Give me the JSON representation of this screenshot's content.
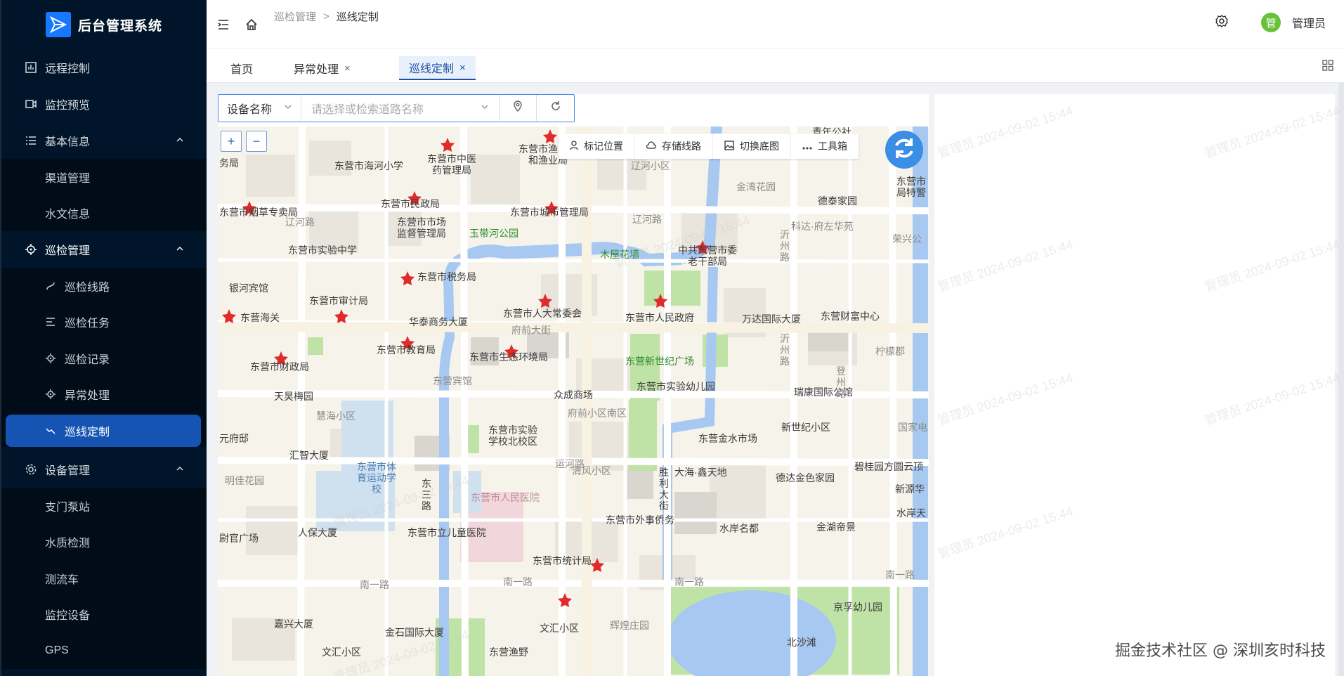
{
  "app": {
    "title": "后台管理系统"
  },
  "sidebar": {
    "items": [
      {
        "label": "远程控制"
      },
      {
        "label": "监控预览"
      },
      {
        "label": "基本信息"
      },
      {
        "label": "渠道管理"
      },
      {
        "label": "水文信息"
      },
      {
        "label": "巡检管理"
      },
      {
        "label": "巡检线路"
      },
      {
        "label": "巡检任务"
      },
      {
        "label": "巡检记录"
      },
      {
        "label": "异常处理"
      },
      {
        "label": "巡线定制"
      },
      {
        "label": "设备管理"
      },
      {
        "label": "支门泵站"
      },
      {
        "label": "水质检测"
      },
      {
        "label": "测流车"
      },
      {
        "label": "监控设备"
      },
      {
        "label": "GPS"
      }
    ]
  },
  "header": {
    "breadcrumb": [
      "巡检管理",
      ">",
      "巡线定制"
    ],
    "user": {
      "avatar_char": "管",
      "name": "管理员"
    }
  },
  "tabs": [
    {
      "label": "首页"
    },
    {
      "label": "异常处理"
    },
    {
      "label": "巡线定制"
    }
  ],
  "search": {
    "select_value": "设备名称",
    "placeholder": "请选择或检索道路名称"
  },
  "map": {
    "zoom_in": "+",
    "zoom_out": "−",
    "toolbar": [
      "标记位置",
      "存储线路",
      "切换底图",
      "工具箱"
    ],
    "roads": [
      "辽河路",
      "辽河路",
      "府前大街",
      "运河路",
      "南一路",
      "南一路",
      "南一路",
      "南一路"
    ],
    "places": [
      "东营市海河小学",
      "东营市中医药管理局",
      "东营市渔发展和渔业局",
      "辽河小区",
      "金湾花园",
      "德泰家园",
      "东营市烟草专卖局",
      "东营市民政局",
      "东营市城市管理局",
      "东营市市场监督管理局",
      "玉带河公园",
      "木屋花墙",
      "中共东营市委老干部局",
      "科达·府左华苑",
      "荣兴公",
      "东营市实验中学",
      "东营市税务局",
      "银河宾馆",
      "东营市审计局",
      "东营市人大常委会",
      "东营市人民政府",
      "万达国际大厦",
      "东营财富中心",
      "东营海关",
      "华泰商务大厦",
      "东营市教育局",
      "东营市生态环境局",
      "东营新世纪广场",
      "柠檬郡",
      "东营市财政局",
      "东营宾馆",
      "东营市实验幼儿园",
      "瑞康国际公馆",
      "天昊梅园",
      "众成商场",
      "府前小区南区",
      "慧海小区",
      "新世纪小区",
      "东营市实验学校北校区",
      "东营金水市场",
      "元府邸",
      "汇智大厦",
      "东营市体育运动学校",
      "清风小区",
      "大海·鑫天地",
      "碧桂园方圆云顶",
      "明佳花园",
      "德达金色家园",
      "新源华",
      "东营市人民医院",
      "东营市外事侨务",
      "水岸名都",
      "金湖帝景",
      "水岸天",
      "尉官广场",
      "人保大厦",
      "东营市立儿童医院",
      "东营市统计局",
      "北沙滩",
      "京孚幼儿园",
      "嘉兴大厦",
      "金石国际大厦",
      "文汇小区",
      "辉煌庄园",
      "文汇小区",
      "东营渔野",
      "胜利大街",
      "东三路",
      "沂州路",
      "沂州路",
      "登州路",
      "青年公社",
      "国家电",
      "务局",
      "东营市局特警"
    ],
    "watermark": "管理员 2024-09-02 15:44"
  },
  "credit": "掘金技术社区 @ 深圳亥时科技"
}
